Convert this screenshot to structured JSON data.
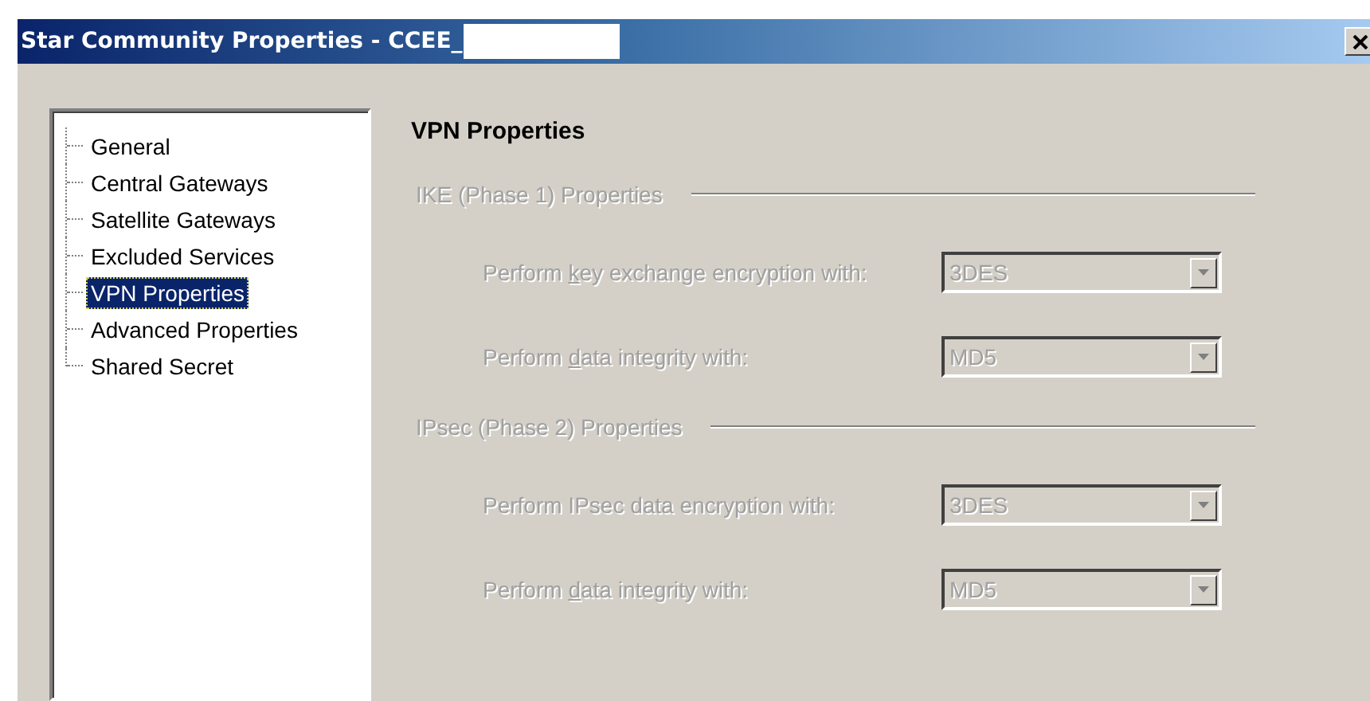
{
  "window": {
    "title": "Star Community Properties - CCEE_",
    "title_redacted": true
  },
  "tree": {
    "items": [
      {
        "label": "General",
        "selected": false
      },
      {
        "label": "Central Gateways",
        "selected": false
      },
      {
        "label": "Satellite Gateways",
        "selected": false
      },
      {
        "label": "Excluded Services",
        "selected": false
      },
      {
        "label": "VPN Properties",
        "selected": true
      },
      {
        "label": "Advanced Properties",
        "selected": false
      },
      {
        "label": "Shared Secret",
        "selected": false
      }
    ]
  },
  "page": {
    "heading": "VPN Properties",
    "groups": [
      {
        "title": "IKE (Phase 1) Properties",
        "disabled": true,
        "rows": [
          {
            "label_before": "Perform ",
            "label_key": "k",
            "label_after": "ey exchange encryption with:",
            "value": "3DES",
            "disabled": true
          },
          {
            "label_before": "Perform ",
            "label_key": "d",
            "label_after": "ata integrity with:",
            "value": "MD5",
            "disabled": true
          }
        ]
      },
      {
        "title": "IPsec (Phase 2) Properties",
        "disabled": true,
        "rows": [
          {
            "label_before": "Perform IPsec data encryption with:",
            "value": "3DES",
            "disabled": true
          },
          {
            "label_before": "Perform ",
            "label_key": "d",
            "label_after": "ata integrity with:",
            "value": "MD5",
            "disabled": true
          }
        ]
      }
    ]
  }
}
